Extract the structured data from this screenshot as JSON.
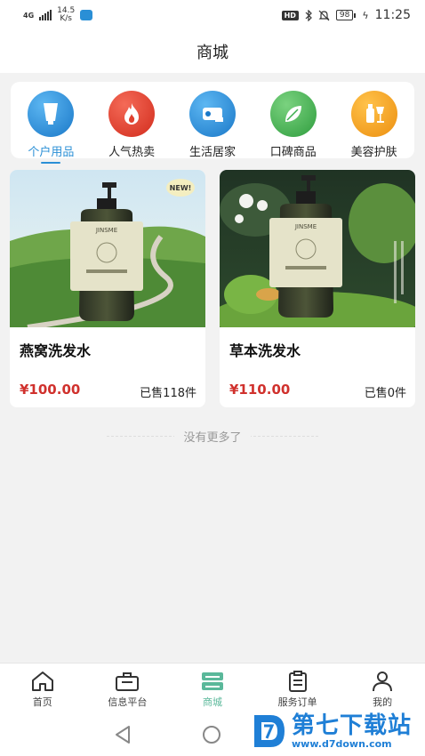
{
  "status_bar": {
    "network": "4G",
    "speed_value": "14.5",
    "speed_unit": "K/s",
    "hd": "HD",
    "battery": "98",
    "time": "11:25"
  },
  "page": {
    "title": "商城"
  },
  "categories": [
    {
      "label": "个户用品",
      "icon": "tube-icon",
      "color": "#2a8fd6",
      "active": true
    },
    {
      "label": "人气热卖",
      "icon": "flame-icon",
      "color": "#e0412f",
      "active": false
    },
    {
      "label": "生活居家",
      "icon": "tissue-roll-icon",
      "color": "#2a8fd6",
      "active": false
    },
    {
      "label": "口碑商品",
      "icon": "leaf-icon",
      "color": "#3dae4f",
      "active": false
    },
    {
      "label": "美容护肤",
      "icon": "cosmetics-icon",
      "color": "#f0a21c",
      "active": false
    }
  ],
  "products": [
    {
      "name": "燕窝洗发水",
      "price": "¥100.00",
      "sold": "已售118件",
      "badge": "NEW!",
      "brand": "JINSME"
    },
    {
      "name": "草本洗发水",
      "price": "¥110.00",
      "sold": "已售0件",
      "brand": "JINSME"
    }
  ],
  "list_end_text": "没有更多了",
  "tabs": [
    {
      "label": "首页",
      "icon": "home-icon",
      "active": false
    },
    {
      "label": "信息平台",
      "icon": "briefcase-icon",
      "active": false
    },
    {
      "label": "商城",
      "icon": "shop-icon",
      "active": true
    },
    {
      "label": "服务订单",
      "icon": "clipboard-icon",
      "active": false
    },
    {
      "label": "我的",
      "icon": "user-icon",
      "active": false
    }
  ],
  "watermark": {
    "title": "第七下载站",
    "url": "www.d7down.com"
  },
  "colors": {
    "accent": "#2a8fd6",
    "price": "#d0312d",
    "tab_active": "#5ab89a"
  }
}
